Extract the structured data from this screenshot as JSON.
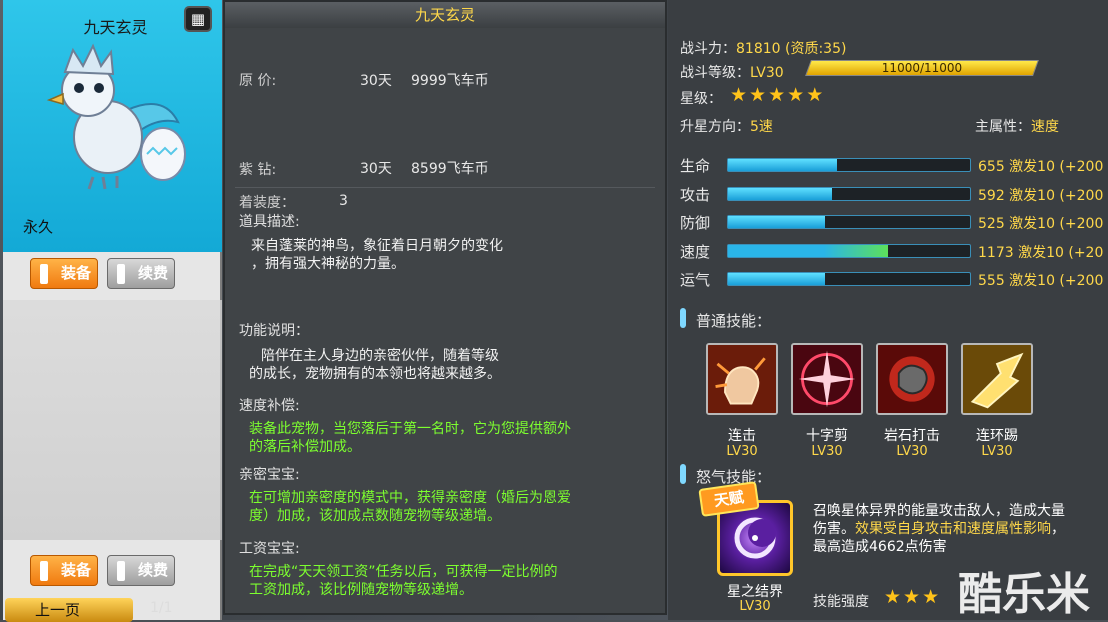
{
  "card": {
    "title": "九天玄灵",
    "calc_icon": "calculator-icon",
    "duration": "永久",
    "equip_label": "装备",
    "renew_label": "续费",
    "prev_label": "上一页",
    "page": "1/1"
  },
  "detail": {
    "title": "九天玄灵",
    "original_price_label": "原 价:",
    "original_days": "30天",
    "original_price": "9999飞车币",
    "purple_label": "紫 钻:",
    "purple_days": "30天",
    "purple_price": "8599飞车币",
    "wear_label": "着装度：",
    "wear_value": "3",
    "desc_label": "道具描述:",
    "desc_line1": "来自蓬莱的神鸟，象征着日月朝夕的变化",
    "desc_line2": "，拥有强大神秘的力量。",
    "function_label": "功能说明：",
    "function_line1": "陪伴在主人身边的亲密伙伴，随着等级",
    "function_line2": "的成长，宠物拥有的本领也将越来越多。",
    "speed_label": "速度补偿:",
    "speed_line1": "装备此宠物，当您落后于第一名时，它为您提供额外",
    "speed_line2": "的落后补偿加成。",
    "intimacy_label": "亲密宝宝:",
    "intimacy_line1": "在可增加亲密度的模式中，获得亲密度（婚后为恩爱",
    "intimacy_line2": "度）加成，该加成点数随宠物等级递增。",
    "salary_label": "工资宝宝:",
    "salary_line1": "在完成“天天领工资”任务以后，可获得一定比例的",
    "salary_line2": "工资加成，该比例随宠物等级递增。"
  },
  "stats": {
    "power_label": "战斗力：",
    "power_value": "81810",
    "qualification": "(资质:35)",
    "level_label": "战斗等级：",
    "level_value": "LV30",
    "exp_text": "11000/11000",
    "exp_fraction": 1.0,
    "star_label": "星级：",
    "stars": 5,
    "upgrade_label": "升星方向：",
    "upgrade_value": "5速",
    "main_attr_label": "主属性：",
    "main_attr_value": "速度",
    "attributes": [
      {
        "name": "生命",
        "value": "655",
        "bonus": "激发10 (+200",
        "fill": 0.45
      },
      {
        "name": "攻击",
        "value": "592",
        "bonus": "激发10 (+200",
        "fill": 0.43
      },
      {
        "name": "防御",
        "value": "525",
        "bonus": "激发10 (+200",
        "fill": 0.4
      },
      {
        "name": "速度",
        "value": "1173",
        "bonus": "激发10 (+20",
        "fill": 0.66
      },
      {
        "name": "运气",
        "value": "555",
        "bonus": "激发10 (+200",
        "fill": 0.4
      }
    ]
  },
  "skills": {
    "normal_label": "普通技能：",
    "list": [
      {
        "name": "连击",
        "level": "LV30",
        "icon": "fist-icon"
      },
      {
        "name": "十字剪",
        "level": "LV30",
        "icon": "cross-slash-icon"
      },
      {
        "name": "岩石打击",
        "level": "LV30",
        "icon": "rock-strike-icon"
      },
      {
        "name": "连环踢",
        "level": "LV30",
        "icon": "combo-kick-icon"
      }
    ],
    "rage_label": "怒气技能：",
    "ult_badge": "天赋",
    "ult_name": "星之结界",
    "ult_level": "LV30",
    "ult_desc_white1": "召唤星体异界的能量攻击敌人，造",
    "ult_desc_white2": "成大量伤害。",
    "ult_desc_yellow": "效果受自身攻击和速度属性影响",
    "ult_desc_white3": "，最高造成4662点伤害",
    "strength_label": "技能强度",
    "strength_stars": 3
  },
  "watermark": "酷乐米"
}
